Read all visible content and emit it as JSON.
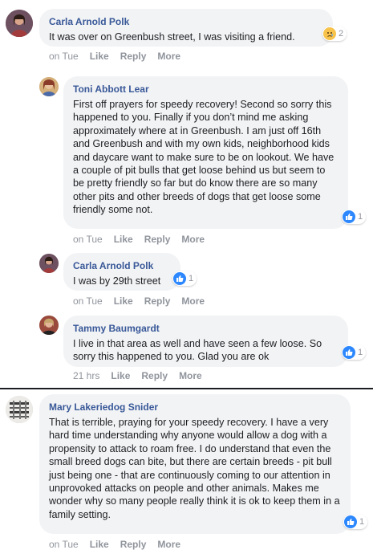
{
  "actions": {
    "like": "Like",
    "reply": "Reply",
    "more": "More"
  },
  "comments": [
    {
      "author": "Carla Arnold Polk",
      "text": "It was over on Greenbush street, I was visiting a friend.",
      "time": "on Tue",
      "reaction": {
        "icon": "sad-face-icon",
        "count": "2"
      }
    },
    {
      "author": "Toni Abbott Lear",
      "text": "First off prayers for speedy recovery! Second so sorry this happened to you. Finally if you don’t mind me asking approximately where at in Greenbush. I am just off 16th and Greenbush and with my own kids, neighborhood kids and daycare want to make sure to be on lookout. We have a couple of pit bulls that get loose behind us but seem to be pretty friendly so far but do know there are so many other pits and other breeds of dogs that get loose some friendly some not.",
      "time": "on Tue",
      "reaction": {
        "icon": "like-icon",
        "count": "1"
      }
    },
    {
      "author": "Carla Arnold Polk",
      "text": "I was by 29th street",
      "time": "on Tue",
      "reaction": {
        "icon": "like-icon",
        "count": "1"
      }
    },
    {
      "author": "Tammy Baumgardt",
      "text": "I live in that area as well and have seen a few loose. So sorry this happened to you. Glad you are ok",
      "time": "21 hrs",
      "reaction": {
        "icon": "like-icon",
        "count": "1"
      }
    },
    {
      "author": "Mary Lakeriedog Snider",
      "text": "That is terrible, praying for your speedy recovery. I have a very hard time understanding why anyone would allow a dog with a propensity to attack to roam free. I do understand that even the small breed dogs can bite, but there are certain breeds - pit bull just being one - that are continuously coming to our attention in unprovoked attacks on people and other animals. Makes me wonder why so many people really think it is ok to keep them in a family setting.",
      "time": "on Tue",
      "reaction": {
        "icon": "like-icon",
        "count": "1"
      }
    }
  ],
  "colors": {
    "author": "#385898",
    "bubble": "#f2f3f5",
    "meta": "#90949c",
    "like": "#2d88ff"
  }
}
